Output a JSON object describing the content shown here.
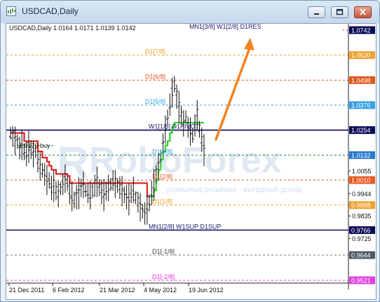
{
  "window": {
    "title": "USDCAD,Daily",
    "symbol_info": "USDCAD,Daily  1.0164 1.0171 1.0139 1.0142"
  },
  "watermark": {
    "brand": "RoboForex",
    "tagline": "успешные решения · выгодный доход"
  },
  "buy_label": "1.0179 buy",
  "chart_data": {
    "type": "line",
    "title": "USDCAD,Daily",
    "ohlc": {
      "open": 1.0164,
      "high": 1.0171,
      "low": 1.0139,
      "close": 1.0142
    },
    "ylim": [
      0.9521,
      1.0742
    ],
    "x_tick_labels": [
      "21 Dec 2011",
      "6 Feb 2012",
      "21 Mar 2012",
      "4 May 2012",
      "19 Jun 2012"
    ],
    "y_tick_labels": [
      "1.0742",
      "1.0620",
      "1.0498",
      "1.0376",
      "1.0254",
      "1.0132",
      "1.0055",
      "1.0010",
      "0.9944",
      "0.9888",
      "0.9835",
      "0.9766",
      "0.9725",
      "0.9644",
      "0.9521"
    ],
    "levels": [
      {
        "label": "MN1[3/8] W1[2/8] D1RES",
        "value": 1.0742,
        "color": "#d01c1c",
        "style": "dash-dot",
        "badge_fill": "#0a0a55",
        "badge_text": "#ffffff",
        "label_color": "#1a1a6a"
      },
      {
        "label": "D1[7/8]",
        "value": 1.062,
        "color": "#e8a020",
        "style": "dash",
        "badge_fill": "#f0a030",
        "badge_text": "#ffffff",
        "label_color": "#e8a020"
      },
      {
        "label": "D1[6/8]",
        "value": 1.0498,
        "color": "#e05020",
        "style": "dash",
        "badge_fill": "#e05a20",
        "badge_text": "#ffffff",
        "label_color": "#e05020"
      },
      {
        "label": "D1[5/8]",
        "value": 1.0376,
        "color": "#30a0e0",
        "style": "dash",
        "badge_fill": "#3aa0e6",
        "badge_text": "#ffffff",
        "label_color": "#30a0e0"
      },
      {
        "label": "W1[1/8] D1PIVOT",
        "value": 1.0254,
        "color": "#0a0a60",
        "style": "solid",
        "badge_fill": "#0a0a55",
        "badge_text": "#ffffff",
        "label_color": "#1a1a6a"
      },
      {
        "label": "",
        "value": 1.0132,
        "color": "#1c8a30",
        "style": "dash",
        "badge_fill": "#2a7bd0",
        "badge_text": "#ffffff",
        "label_color": "#1c8a30"
      },
      {
        "label": "D1[3/8]",
        "value": 1.0132,
        "color": "#30a0e0",
        "style": "none",
        "badge_fill": "",
        "badge_text": "",
        "label_color": "#30a0e0"
      },
      {
        "label": "D1[2/8]",
        "value": 1.001,
        "color": "#e05020",
        "style": "dash",
        "badge_fill": "#e85a20",
        "badge_text": "#ffffff",
        "label_color": "#e05020"
      },
      {
        "label": "D1[1/8]",
        "value": 0.9888,
        "color": "#e8a020",
        "style": "dash",
        "badge_fill": "#f0a030",
        "badge_text": "#ffffff",
        "label_color": "#e8a020"
      },
      {
        "label": "MN1[2/8] W1SUP D1SUP",
        "value": 0.9766,
        "color": "#0a0a60",
        "style": "solid",
        "badge_fill": "#0a0a55",
        "badge_text": "#ffffff",
        "label_color": "#1a1a6a"
      },
      {
        "label": "D1[-1/8]",
        "value": 0.9644,
        "color": "#707070",
        "style": "dash",
        "badge_fill": "#505a66",
        "badge_text": "#ffffff",
        "label_color": "#404040"
      },
      {
        "label": "D1[-2/8]",
        "value": 0.9521,
        "color": "#e030e0",
        "style": "dash",
        "badge_fill": "#e040e0",
        "badge_text": "#ffffff",
        "label_color": "#e030e0"
      }
    ],
    "price_series": [
      1.024,
      1.0225,
      1.0205,
      1.02,
      1.017,
      1.0185,
      1.015,
      1.014,
      1.0175,
      1.016,
      1.014,
      1.015,
      1.01,
      1.008,
      1.006,
      1.004,
      1.0015,
      1.001,
      0.9975,
      0.9985,
      0.996,
      0.9945,
      0.997,
      0.999,
      1.002,
      0.9995,
      0.995,
      0.9935,
      0.9915,
      0.993,
      0.995,
      0.9975,
      0.999,
      0.996,
      0.995,
      0.994,
      0.996,
      0.9985,
      1.0005,
      0.9975,
      0.9955,
      0.994,
      0.996,
      0.9975,
      0.999,
      1.001,
      0.9995,
      0.9985,
      0.9975,
      0.996,
      0.994,
      0.993,
      0.992,
      0.9945,
      0.9965,
      0.9925,
      0.9905,
      0.988,
      0.986,
      0.985,
      0.987,
      0.99,
      0.995,
      0.999,
      1.004,
      1.008,
      1.013,
      1.019,
      1.026,
      1.032,
      1.038,
      1.044,
      1.048,
      1.042,
      1.037,
      1.033,
      1.029,
      1.032,
      1.027,
      1.025,
      1.023,
      1.028,
      1.033,
      1.026,
      1.021,
      1.016
    ],
    "stop_series": [
      1.024,
      1.024,
      1.024,
      1.024,
      1.024,
      1.024,
      1.02,
      1.02,
      1.02,
      1.02,
      1.02,
      1.02,
      1.015,
      1.015,
      1.012,
      1.012,
      1.01,
      1.008,
      1.006,
      1.006,
      1.004,
      1.004,
      1.004,
      1.004,
      1.004,
      1.003,
      0.9995,
      0.9995,
      0.9995,
      0.9995,
      0.9995,
      0.9995,
      0.9995,
      0.9995,
      0.9995,
      0.9995,
      0.9995,
      0.9995,
      0.9995,
      0.9995,
      0.9995,
      0.9995,
      0.9995,
      0.9995,
      0.9995,
      0.9995,
      0.9995,
      0.9995,
      0.9995,
      0.9995,
      0.9995,
      0.9995,
      0.9995,
      0.9995,
      0.9995,
      0.9995,
      0.9995,
      0.9995,
      0.9995,
      0.9995,
      0.993,
      0.993,
      0.993,
      0.996,
      1.001,
      1.006,
      1.011,
      1.015,
      1.018,
      1.02,
      1.024,
      1.027,
      1.029,
      1.029,
      1.029,
      1.029,
      1.029,
      1.029,
      1.029,
      1.029,
      1.029,
      1.029,
      1.029,
      1.029,
      1.029,
      1.029
    ],
    "stop_colors": {
      "down": "#e01010",
      "up": "#22cc22"
    },
    "stop_turn_index": 61,
    "stop_end_index": 85,
    "projection": {
      "from_value": 1.0208,
      "to_value": 1.0705,
      "color": "#f58220"
    },
    "grid": false,
    "legend": "none"
  }
}
